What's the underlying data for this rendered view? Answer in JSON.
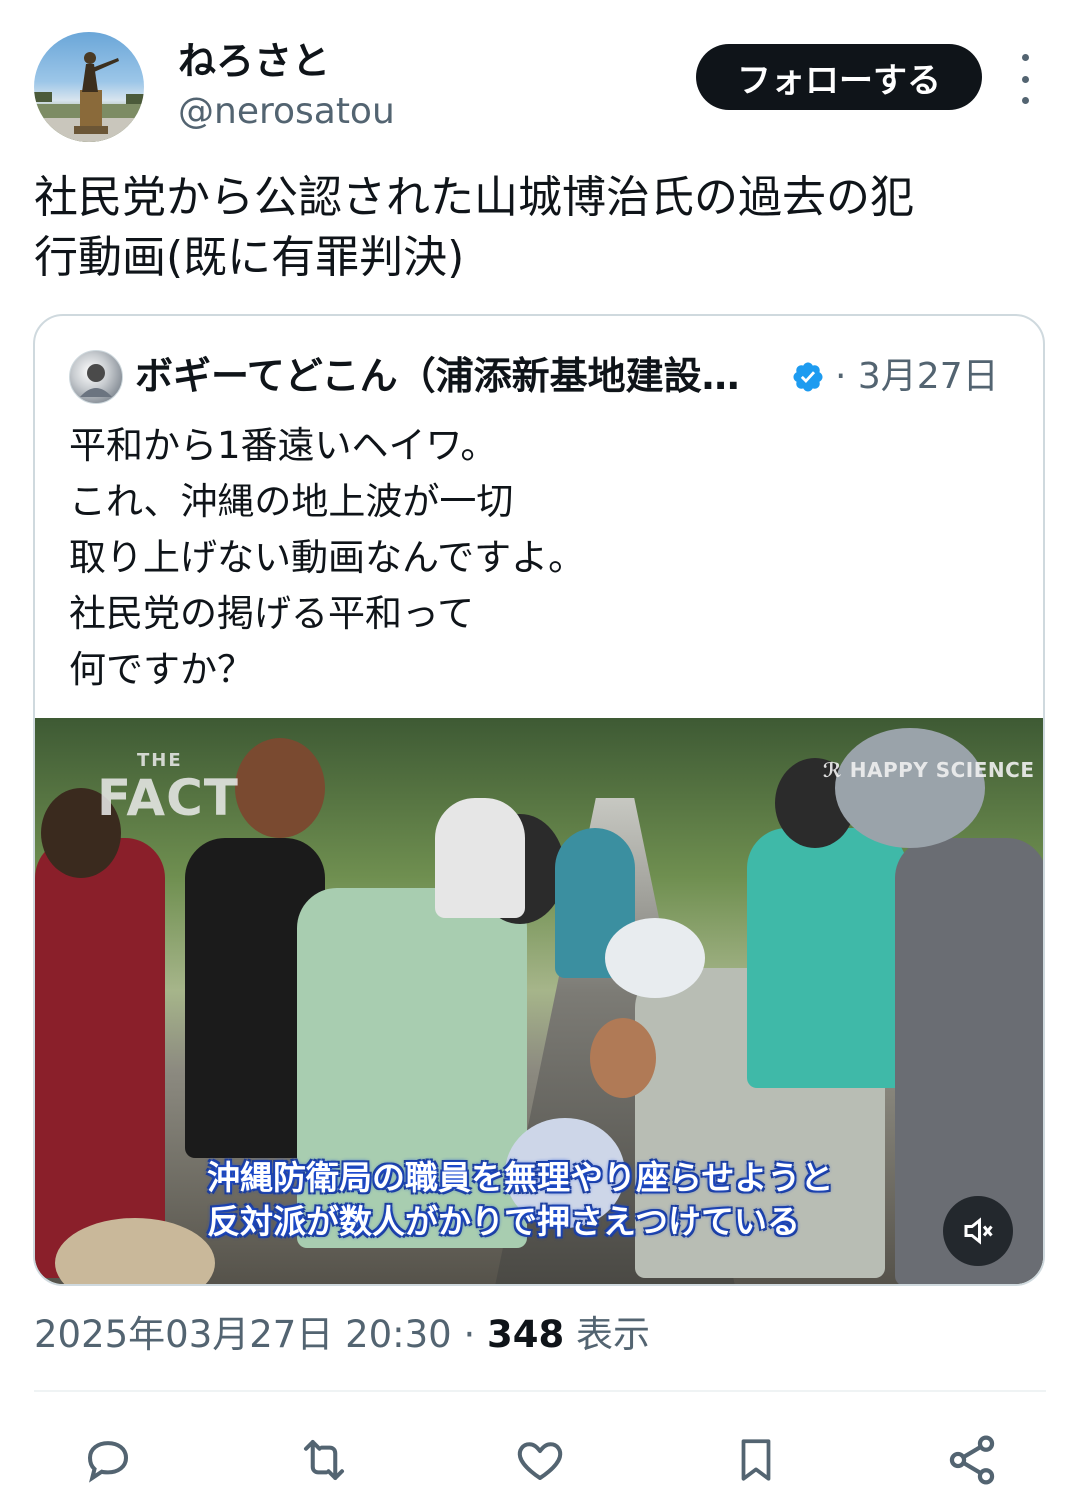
{
  "author": {
    "display_name": "ねろさと",
    "handle": "@nerosatou",
    "follow_label": "フォローする"
  },
  "tweet": {
    "text": "社民党から公認された山城博治氏の過去の犯\n行動画(既に有罪判決)"
  },
  "quote": {
    "author_name": "ボギーてどこん（浦添新基地建設…",
    "separator_date": "· 3月27日",
    "text": "平和から1番遠いヘイワ。\nこれ、沖縄の地上波が一切\n取り上げない動画なんですよ。\n社民党の掲げる平和って\n何ですか？",
    "video": {
      "watermark_the": "THE",
      "watermark_fact": "FACT",
      "watermark_channel": "HAPPY SCIENCE",
      "subtitle_line1": "沖縄防衛局の職員を無理やり座らせようと",
      "subtitle_line2": "反対派が数人がかりで押さえつけている",
      "muted": true
    }
  },
  "meta": {
    "timestamp": "2025年03月27日 20:30 · ",
    "views_count": "348",
    "views_label": " 表示"
  },
  "actions": [
    "reply-icon",
    "retweet-icon",
    "like-icon",
    "bookmark-icon",
    "share-icon"
  ],
  "colors": {
    "text_primary": "#0f1419",
    "text_secondary": "#536471",
    "verified_blue": "#1d9bf0",
    "border": "#cfd9de"
  }
}
